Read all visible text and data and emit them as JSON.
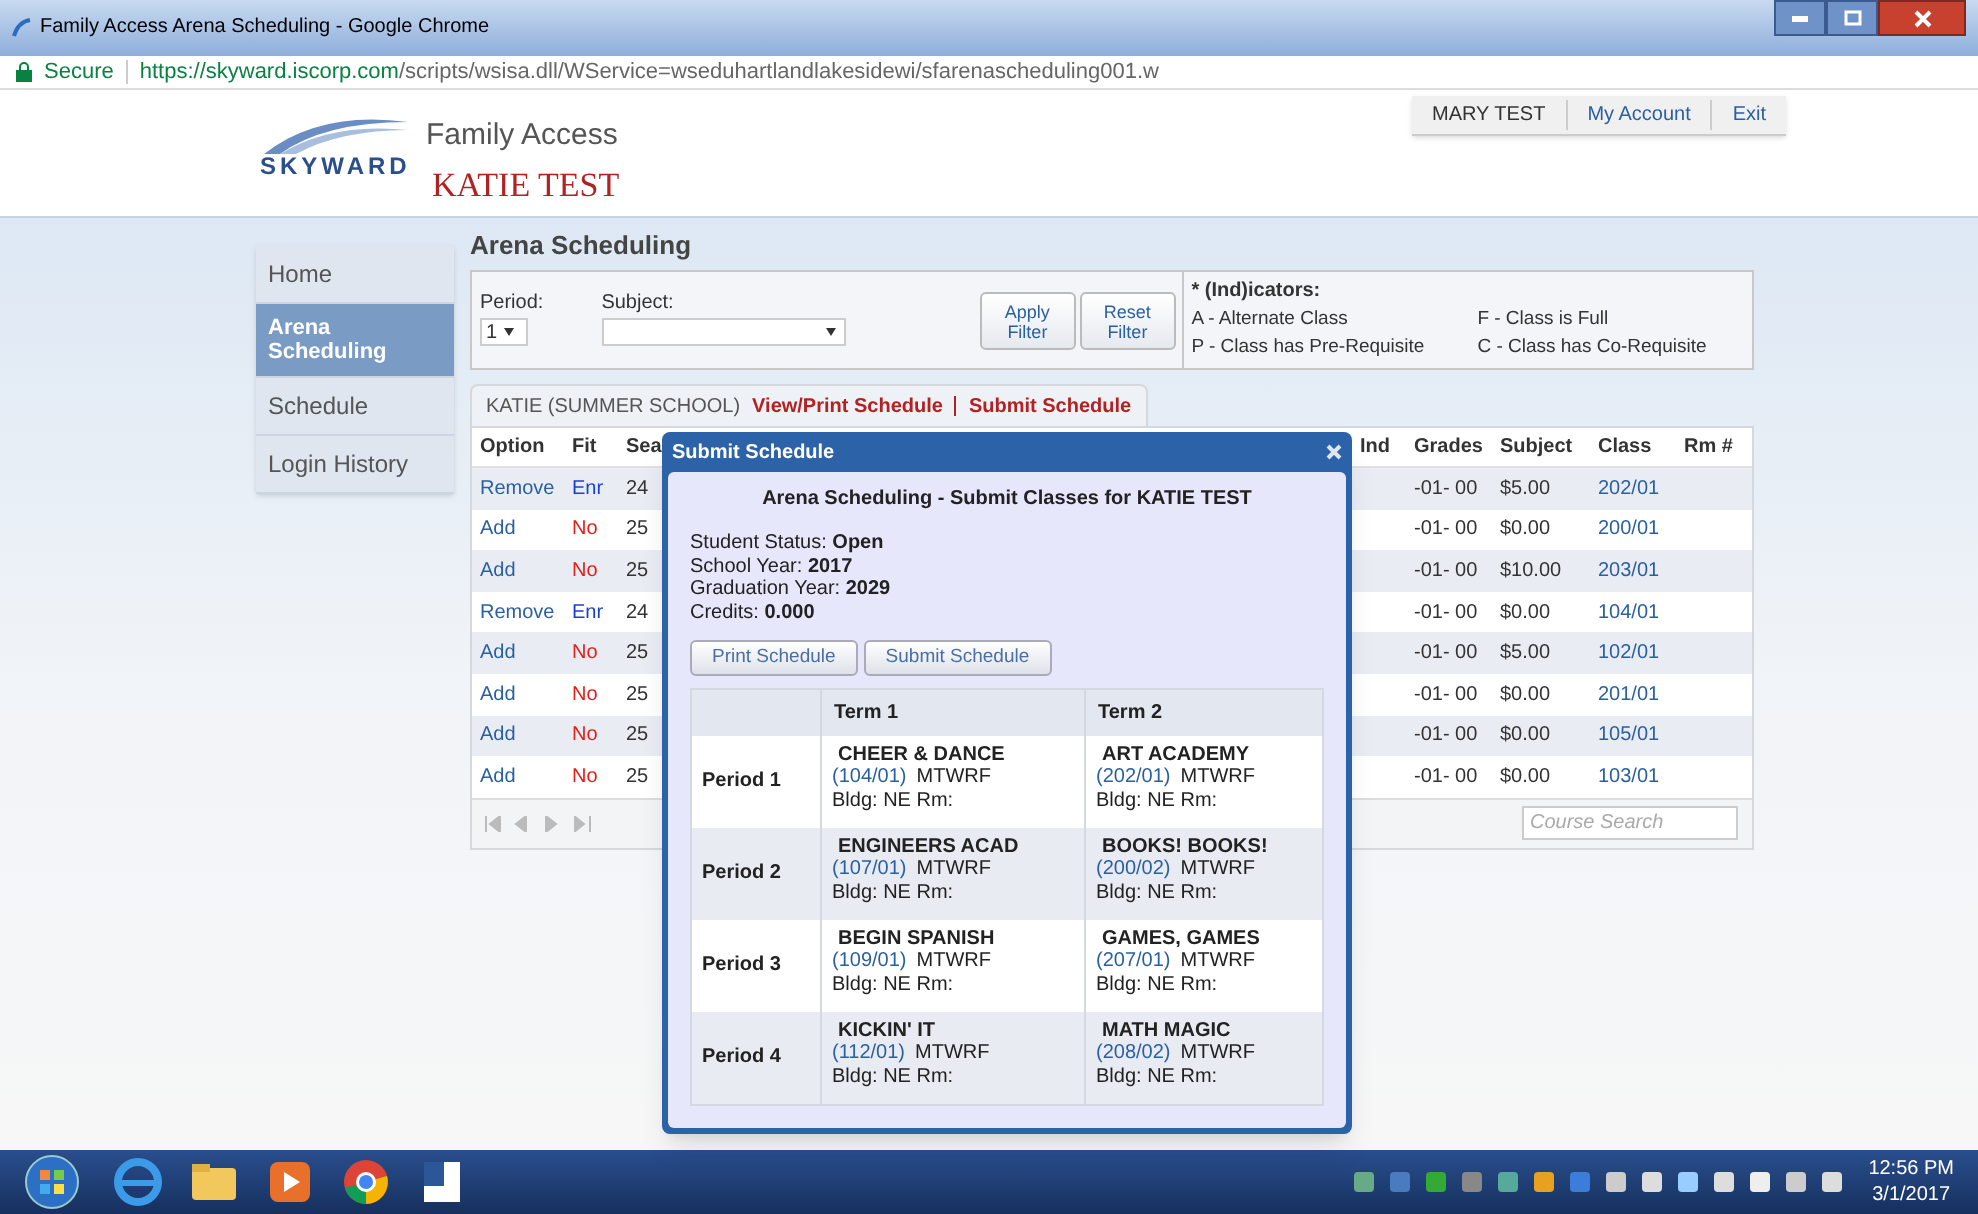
{
  "window": {
    "title": "Family Access Arena Scheduling - Google Chrome"
  },
  "address_bar": {
    "secure_label": "Secure",
    "url_host": "https://skyward.iscorp.com",
    "url_path": "/scripts/wsisa.dll/WService=wseduhartlandlakesidewi/sfarenascheduling001.w"
  },
  "header": {
    "logo": "SKYWARD",
    "app_name": "Family Access",
    "student": "KATIE TEST",
    "user_menu": [
      "MARY TEST",
      "My Account",
      "Exit"
    ]
  },
  "sidebar": {
    "items": [
      {
        "label": "Home",
        "selected": false
      },
      {
        "label": "Arena Scheduling",
        "selected": true
      },
      {
        "label": "Schedule",
        "selected": false
      },
      {
        "label": "Login History",
        "selected": false
      }
    ]
  },
  "page_title": "Arena Scheduling",
  "filters": {
    "period": {
      "label": "Period:",
      "value": "1"
    },
    "subject": {
      "label": "Subject:"
    },
    "buttons": [
      "Apply Filter",
      "Reset Filter"
    ]
  },
  "indicators": {
    "title": "* (Ind)icators:",
    "items": [
      "A - Alternate Class",
      "F - Class is Full",
      "P - Class has Pre-Requisite",
      "C - Class has Co-Requisite"
    ]
  },
  "tab_strip": {
    "student": "KATIE (SUMMER SCHOOL)",
    "links": [
      "View/Print Schedule",
      "Submit Schedule"
    ]
  },
  "table": {
    "columns": [
      "Option",
      "Fit",
      "Sea",
      "Ind",
      "Grades",
      "Subject",
      "Class",
      "Rm #"
    ],
    "rows": [
      {
        "option": "Remove",
        "fit": "Enr",
        "enrolled": true,
        "seats": "24",
        "grades": "-01- 00",
        "subject": "$5.00",
        "class": "202/01"
      },
      {
        "option": "Add",
        "fit": "No",
        "enrolled": false,
        "seats": "25",
        "grades": "-01- 00",
        "subject": "$0.00",
        "class": "200/01"
      },
      {
        "option": "Add",
        "fit": "No",
        "enrolled": false,
        "seats": "25",
        "grades": "-01- 00",
        "subject": "$10.00",
        "class": "203/01"
      },
      {
        "option": "Remove",
        "fit": "Enr",
        "enrolled": true,
        "seats": "24",
        "grades": "-01- 00",
        "subject": "$0.00",
        "class": "104/01"
      },
      {
        "option": "Add",
        "fit": "No",
        "enrolled": false,
        "seats": "25",
        "grades": "-01- 00",
        "subject": "$5.00",
        "class": "102/01"
      },
      {
        "option": "Add",
        "fit": "No",
        "enrolled": false,
        "seats": "25",
        "grades": "-01- 00",
        "subject": "$0.00",
        "class": "201/01"
      },
      {
        "option": "Add",
        "fit": "No",
        "enrolled": false,
        "seats": "25",
        "grades": "-01- 00",
        "subject": "$0.00",
        "class": "105/01"
      },
      {
        "option": "Add",
        "fit": "No",
        "enrolled": false,
        "seats": "25",
        "grades": "-01- 00",
        "subject": "$0.00",
        "class": "103/01"
      }
    ],
    "search": {
      "placeholder": "Course Search"
    }
  },
  "modal": {
    "title": "Submit Schedule",
    "heading": "Arena Scheduling - Submit Classes for KATIE TEST",
    "fields": [
      "Student Status: **Open**",
      "School Year: **2017**",
      "Graduation Year: **2029**",
      "Credits: **0.000**"
    ],
    "buttons": [
      "Print Schedule",
      "Submit Schedule"
    ],
    "term_headers": [
      "Term 1",
      "Term 2"
    ],
    "periods": [
      {
        "label": "Period 1",
        "classes": [
          {
            "name": "CHEER & DANCE",
            "code": "(104/01)",
            "days": "MTWRF",
            "location": "Bldg: NE Rm:"
          },
          {
            "name": "ART ACADEMY",
            "code": "(202/01)",
            "days": "MTWRF",
            "location": "Bldg: NE Rm:"
          }
        ]
      },
      {
        "label": "Period 2",
        "classes": [
          {
            "name": "ENGINEERS ACAD",
            "code": "(107/01)",
            "days": "MTWRF",
            "location": "Bldg: NE Rm:"
          },
          {
            "name": "BOOKS! BOOKS!",
            "code": "(200/02)",
            "days": "MTWRF",
            "location": "Bldg: NE Rm:"
          }
        ]
      },
      {
        "label": "Period 3",
        "classes": [
          {
            "name": "BEGIN SPANISH",
            "code": "(109/01)",
            "days": "MTWRF",
            "location": "Bldg: NE Rm:"
          },
          {
            "name": "GAMES, GAMES",
            "code": "(207/01)",
            "days": "MTWRF",
            "location": "Bldg: NE Rm:"
          }
        ]
      },
      {
        "label": "Period 4",
        "classes": [
          {
            "name": "KICKIN' IT",
            "code": "(112/01)",
            "days": "MTWRF",
            "location": "Bldg: NE Rm:"
          },
          {
            "name": "MATH MAGIC",
            "code": "(208/02)",
            "days": "MTWRF",
            "location": "Bldg: NE Rm:"
          }
        ]
      }
    ]
  },
  "taskbar": {
    "time": "12:56 PM",
    "date": "3/1/2017"
  }
}
